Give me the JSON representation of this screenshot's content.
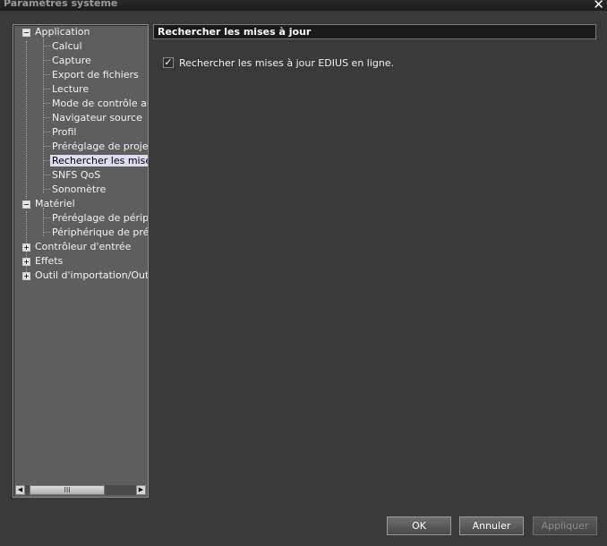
{
  "window": {
    "title": "Paramètres système",
    "close_glyph": "✕"
  },
  "tree": {
    "items": [
      {
        "label": "Application",
        "expander": "−"
      },
      {
        "label": "Calcul"
      },
      {
        "label": "Capture"
      },
      {
        "label": "Export de fichiers"
      },
      {
        "label": "Lecture"
      },
      {
        "label": "Mode de contrôle audi"
      },
      {
        "label": "Navigateur source"
      },
      {
        "label": "Profil"
      },
      {
        "label": "Préréglage de projets"
      },
      {
        "label": "Rechercher les mises à",
        "selected": true
      },
      {
        "label": "SNFS QoS"
      },
      {
        "label": "Sonomètre"
      },
      {
        "label": "Matériel",
        "expander": "−"
      },
      {
        "label": "Préréglage de périphé"
      },
      {
        "label": "Périphérique de prévis"
      },
      {
        "label": "Contrôleur d'entrée",
        "expander": "+"
      },
      {
        "label": "Effets",
        "expander": "+"
      },
      {
        "label": "Outil d'importation/Outil d'",
        "expander": "+"
      }
    ],
    "scrollbar": {
      "left": "◀",
      "thumb": "III",
      "right": "▶"
    }
  },
  "content": {
    "header": "Rechercher les mises à jour",
    "checkbox": {
      "label": "Rechercher les mises à jour EDIUS en ligne.",
      "checked": true,
      "mark": "✓"
    }
  },
  "buttons": {
    "ok": "OK",
    "cancel": "Annuler",
    "apply": "Appliquer"
  }
}
